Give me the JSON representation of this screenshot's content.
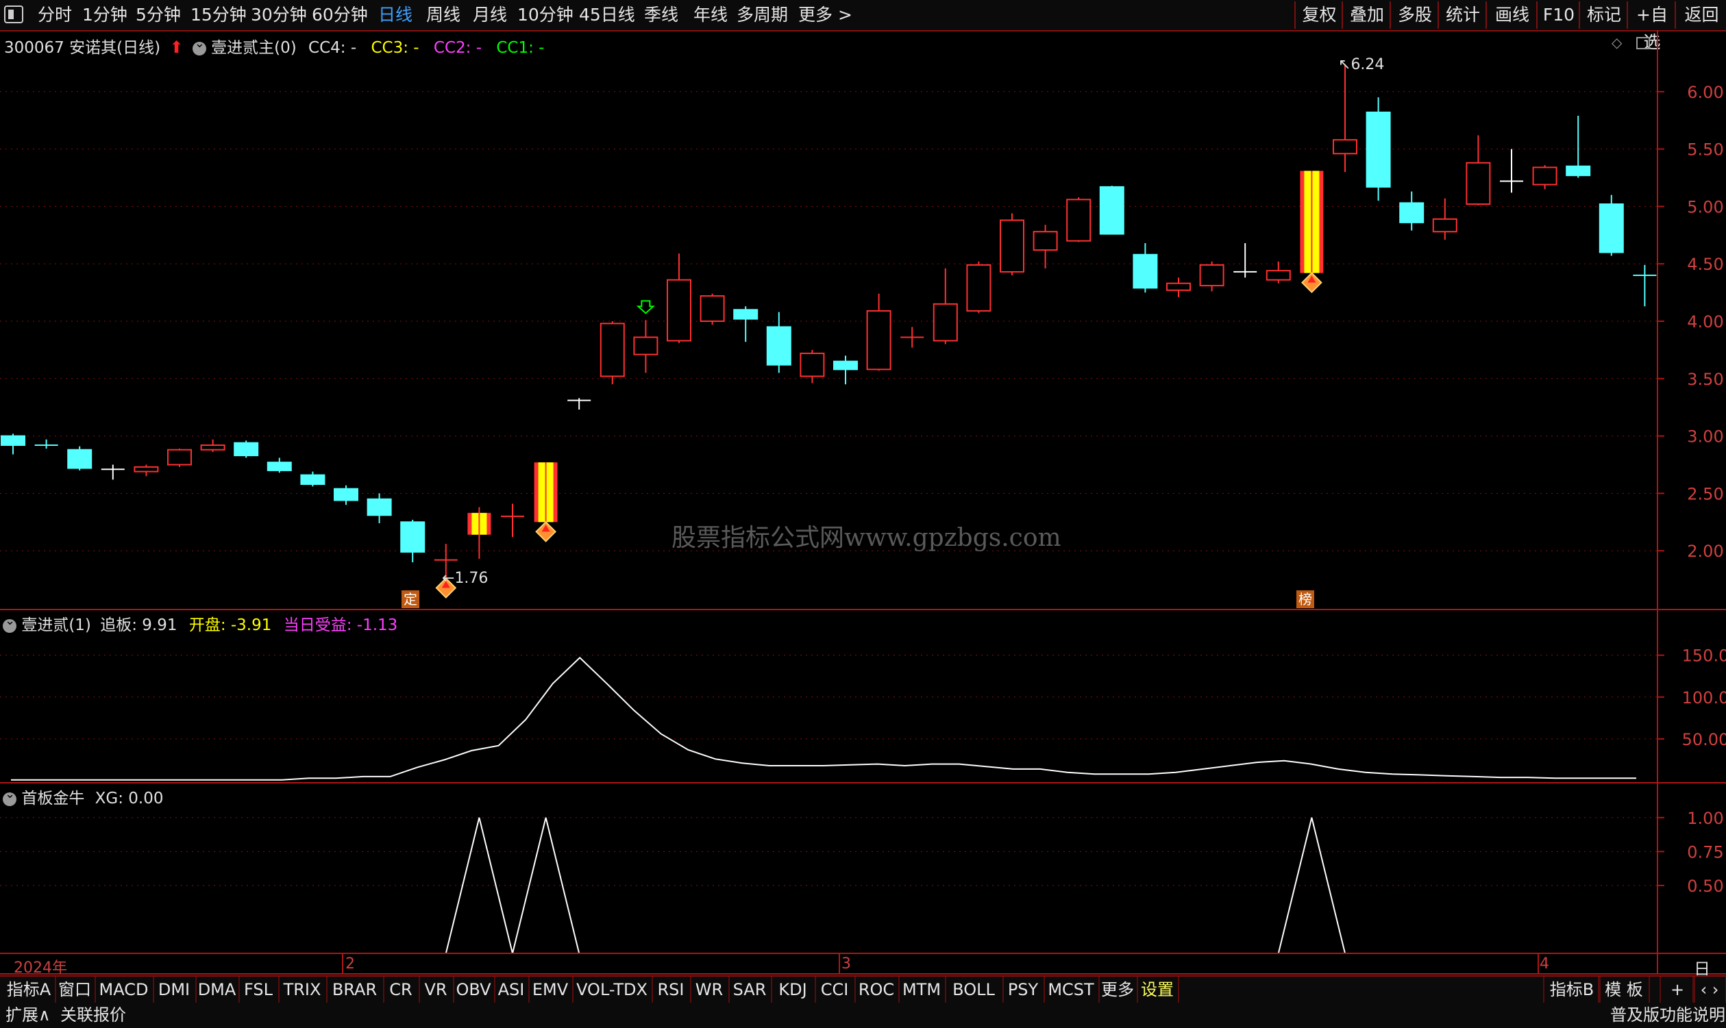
{
  "toolbar": {
    "periods": [
      "分时",
      "1分钟",
      "5分钟",
      "15分钟",
      "30分钟",
      "60分钟",
      "日线",
      "周线",
      "月线",
      "10分钟",
      "45日线",
      "季线",
      "年线",
      "多周期",
      "更多 >"
    ],
    "active": "日线",
    "right_buttons": [
      "复权",
      "叠加",
      "多股",
      "统计",
      "画线",
      "F10",
      "标记",
      "+自选",
      "返回"
    ]
  },
  "main_header": {
    "stock": "300067 安诺其(日线)",
    "indicator": "壹进贰主(0)",
    "cc4": "CC4: -",
    "cc3": "CC3: -",
    "cc2": "CC2: -",
    "cc1": "CC1: -"
  },
  "main_chart": {
    "y_ticks": [
      "6.00",
      "5.50",
      "5.00",
      "4.50",
      "4.00",
      "3.50",
      "3.00",
      "2.50",
      "2.00"
    ],
    "high_label": "6.24",
    "low_label": "1.76",
    "tag_ding": "定",
    "tag_bang": "榜",
    "watermark": "股票指标公式网www.gpzbgs.com"
  },
  "chart_data": [
    {
      "type": "candlestick",
      "name": "main",
      "ylim": [
        1.5,
        6.5
      ],
      "candles": [
        {
          "o": 3.0,
          "h": 3.02,
          "l": 2.84,
          "c": 2.92,
          "s": "cyan"
        },
        {
          "o": 2.93,
          "h": 2.97,
          "l": 2.89,
          "c": 2.92,
          "s": "cross_c"
        },
        {
          "o": 2.88,
          "h": 2.91,
          "l": 2.7,
          "c": 2.72,
          "s": "cyan"
        },
        {
          "o": 2.7,
          "h": 2.75,
          "l": 2.62,
          "c": 2.71,
          "s": "cross_w"
        },
        {
          "o": 2.69,
          "h": 2.75,
          "l": 2.65,
          "c": 2.73,
          "s": "red"
        },
        {
          "o": 2.75,
          "h": 2.89,
          "l": 2.73,
          "c": 2.88,
          "s": "red"
        },
        {
          "o": 2.88,
          "h": 2.97,
          "l": 2.86,
          "c": 2.92,
          "s": "red"
        },
        {
          "o": 2.94,
          "h": 2.96,
          "l": 2.81,
          "c": 2.83,
          "s": "cyan"
        },
        {
          "o": 2.77,
          "h": 2.81,
          "l": 2.68,
          "c": 2.7,
          "s": "cyan"
        },
        {
          "o": 2.66,
          "h": 2.69,
          "l": 2.56,
          "c": 2.58,
          "s": "cyan"
        },
        {
          "o": 2.54,
          "h": 2.57,
          "l": 2.4,
          "c": 2.44,
          "s": "cyan"
        },
        {
          "o": 2.45,
          "h": 2.5,
          "l": 2.24,
          "c": 2.31,
          "s": "cyan"
        },
        {
          "o": 2.25,
          "h": 2.27,
          "l": 1.9,
          "c": 1.99,
          "s": "cyan"
        },
        {
          "o": 1.93,
          "h": 2.06,
          "l": 1.76,
          "c": 1.92,
          "s": "cross_r"
        },
        {
          "o": 2.14,
          "h": 2.38,
          "l": 1.93,
          "c": 2.33,
          "s": "zt"
        },
        {
          "o": 2.3,
          "h": 2.41,
          "l": 2.12,
          "c": 2.3,
          "s": "cross_r"
        },
        {
          "o": 2.25,
          "h": 2.77,
          "l": 2.25,
          "c": 2.77,
          "s": "zt"
        },
        {
          "o": 3.31,
          "h": 3.33,
          "l": 3.23,
          "c": 3.31,
          "s": "cross_w"
        },
        {
          "o": 3.52,
          "h": 4.0,
          "l": 3.45,
          "c": 3.98,
          "s": "red"
        },
        {
          "o": 3.71,
          "h": 4.01,
          "l": 3.55,
          "c": 3.86,
          "s": "red"
        },
        {
          "o": 3.83,
          "h": 4.59,
          "l": 3.81,
          "c": 4.36,
          "s": "red"
        },
        {
          "o": 4.0,
          "h": 4.24,
          "l": 3.97,
          "c": 4.22,
          "s": "red"
        },
        {
          "o": 4.1,
          "h": 4.13,
          "l": 3.82,
          "c": 4.02,
          "s": "cyan"
        },
        {
          "o": 3.95,
          "h": 4.08,
          "l": 3.55,
          "c": 3.62,
          "s": "cyan"
        },
        {
          "o": 3.52,
          "h": 3.75,
          "l": 3.46,
          "c": 3.72,
          "s": "red"
        },
        {
          "o": 3.65,
          "h": 3.7,
          "l": 3.45,
          "c": 3.58,
          "s": "cyan"
        },
        {
          "o": 3.58,
          "h": 4.24,
          "l": 3.57,
          "c": 4.09,
          "s": "red"
        },
        {
          "o": 3.86,
          "h": 3.95,
          "l": 3.77,
          "c": 3.86,
          "s": "cross_r"
        },
        {
          "o": 3.83,
          "h": 4.46,
          "l": 3.8,
          "c": 4.15,
          "s": "red"
        },
        {
          "o": 4.09,
          "h": 4.52,
          "l": 4.07,
          "c": 4.49,
          "s": "red"
        },
        {
          "o": 4.43,
          "h": 4.94,
          "l": 4.4,
          "c": 4.88,
          "s": "red"
        },
        {
          "o": 4.62,
          "h": 4.84,
          "l": 4.46,
          "c": 4.78,
          "s": "red"
        },
        {
          "o": 4.7,
          "h": 5.08,
          "l": 4.69,
          "c": 5.06,
          "s": "red"
        },
        {
          "o": 5.17,
          "h": 5.18,
          "l": 4.76,
          "c": 4.76,
          "s": "cyan"
        },
        {
          "o": 4.58,
          "h": 4.68,
          "l": 4.25,
          "c": 4.29,
          "s": "cyan"
        },
        {
          "o": 4.27,
          "h": 4.38,
          "l": 4.21,
          "c": 4.33,
          "s": "red"
        },
        {
          "o": 4.31,
          "h": 4.52,
          "l": 4.26,
          "c": 4.49,
          "s": "red"
        },
        {
          "o": 4.43,
          "h": 4.68,
          "l": 4.38,
          "c": 4.43,
          "s": "cross_w"
        },
        {
          "o": 4.36,
          "h": 4.52,
          "l": 4.33,
          "c": 4.44,
          "s": "red"
        },
        {
          "o": 4.42,
          "h": 5.31,
          "l": 4.42,
          "c": 5.31,
          "s": "zt"
        },
        {
          "o": 5.46,
          "h": 6.24,
          "l": 5.3,
          "c": 5.58,
          "s": "red"
        },
        {
          "o": 5.82,
          "h": 5.95,
          "l": 5.05,
          "c": 5.17,
          "s": "cyan"
        },
        {
          "o": 5.03,
          "h": 5.13,
          "l": 4.79,
          "c": 4.86,
          "s": "cyan"
        },
        {
          "o": 4.78,
          "h": 5.07,
          "l": 4.71,
          "c": 4.89,
          "s": "red"
        },
        {
          "o": 5.02,
          "h": 5.62,
          "l": 5.01,
          "c": 5.38,
          "s": "red"
        },
        {
          "o": 5.22,
          "h": 5.5,
          "l": 5.12,
          "c": 5.22,
          "s": "cross_w"
        },
        {
          "o": 5.19,
          "h": 5.36,
          "l": 5.15,
          "c": 5.34,
          "s": "red"
        },
        {
          "o": 5.35,
          "h": 5.79,
          "l": 5.25,
          "c": 5.27,
          "s": "cyan"
        },
        {
          "o": 5.02,
          "h": 5.1,
          "l": 4.57,
          "c": 4.6,
          "s": "cyan"
        },
        {
          "o": 4.44,
          "h": 4.49,
          "l": 4.13,
          "c": 4.4,
          "s": "cross_c"
        }
      ],
      "markers": {
        "down_arrow_green": 19,
        "signal_diamond": [
          13,
          16,
          39
        ],
        "ding_tag": 12,
        "bang_tag": 39
      }
    },
    {
      "type": "line",
      "name": "壹进贰",
      "ylim": [
        0,
        180
      ],
      "values": [
        1,
        1,
        1,
        1,
        1,
        1,
        1,
        1,
        1,
        1,
        1,
        3,
        3,
        5,
        5,
        16,
        25,
        36,
        42,
        73,
        116,
        147,
        116,
        84,
        56,
        37,
        26,
        21,
        18,
        18,
        18,
        19,
        20,
        18,
        20,
        20,
        17,
        14,
        14,
        10,
        8,
        8,
        8,
        10,
        14,
        18,
        22,
        24,
        20,
        14,
        10,
        8,
        7,
        6,
        5,
        4,
        4,
        3,
        3,
        3,
        3
      ]
    },
    {
      "type": "line",
      "name": "首板金牛",
      "ylim": [
        0,
        1.12
      ],
      "x_labels": [
        "2024年",
        "2",
        "3",
        "4"
      ],
      "values": [
        0,
        0,
        0,
        0,
        0,
        0,
        0,
        0,
        0,
        0,
        0,
        0,
        0,
        0,
        1,
        0,
        1,
        0,
        0,
        0,
        0,
        0,
        0,
        0,
        0,
        0,
        0,
        0,
        0,
        0,
        0,
        0,
        0,
        0,
        0,
        0,
        0,
        0,
        0,
        1,
        0,
        0,
        0,
        0,
        0,
        0,
        0,
        0,
        0,
        0
      ]
    }
  ],
  "sub1_header": {
    "name": "壹进贰(1)",
    "v1_label": "追板:",
    "v1": "9.91",
    "v2_label": "开盘:",
    "v2": "-3.91",
    "v3_label": "当日受益:",
    "v3": "-1.13"
  },
  "sub1_chart": {
    "y_ticks": [
      "150.0",
      "100.0",
      "50.00"
    ]
  },
  "sub2_header": {
    "name": "首板金牛",
    "xg": "XG: 0.00"
  },
  "sub2_chart": {
    "y_ticks": [
      "1.00",
      "0.75",
      "0.50"
    ]
  },
  "x_axis": {
    "labels": [
      "2024年",
      "2",
      "3",
      "4"
    ],
    "right": "日线"
  },
  "indicator_bar": {
    "items": [
      "指标A",
      "窗口",
      "MACD",
      "DMI",
      "DMA",
      "FSL",
      "TRIX",
      "BRAR",
      "CR",
      "VR",
      "OBV",
      "ASI",
      "EMV",
      "VOL-TDX",
      "RSI",
      "WR",
      "SAR",
      "KDJ",
      "CCI",
      "ROC",
      "MTM",
      "BOLL",
      "PSY",
      "MCST",
      "更多",
      "设置"
    ],
    "right_items": [
      "指标B",
      "模 板",
      "+",
      "‹ ›"
    ]
  },
  "status_bar": {
    "expand": "扩展∧",
    "quote": "关联报价",
    "right": "普及版功能说明"
  },
  "colors": {
    "red": "#ff3030",
    "cyan": "#54ffff",
    "yellow": "#ffff00",
    "magenta": "#ff40ff",
    "green": "#00ff00",
    "gridline": "#8a1010",
    "axis": "#b01515",
    "blue": "#3fa0ff"
  }
}
